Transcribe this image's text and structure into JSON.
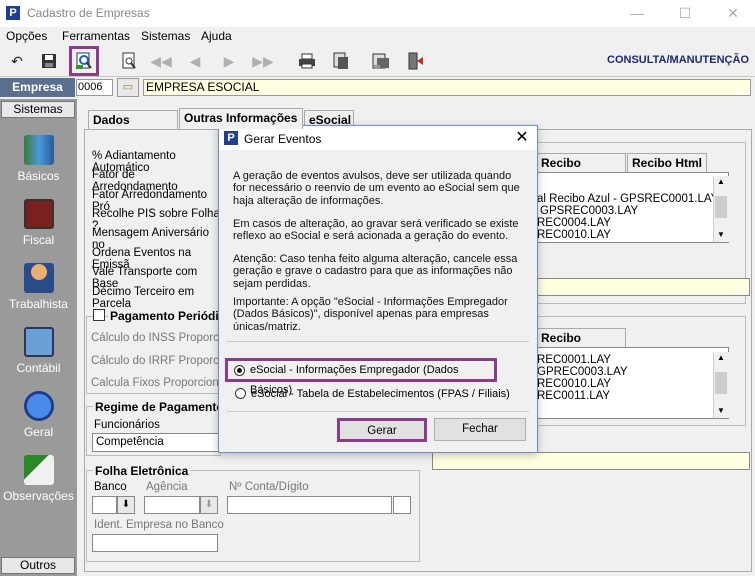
{
  "window": {
    "title": "Cadastro de Empresas",
    "icon_letter": "P",
    "minimize": "—",
    "maximize": "☐",
    "close": "✕"
  },
  "menu": [
    "Opções",
    "Ferramentas",
    "Sistemas",
    "Ajuda"
  ],
  "toolbar": {
    "mode_label": "CONSULTA/MANUTENÇÃO"
  },
  "empresa": {
    "label": "Empresa",
    "code": "0006",
    "name": "EMPRESA ESOCIAL"
  },
  "sidebar": {
    "header": "Sistemas",
    "footer": "Outros",
    "items": [
      {
        "label": "Básicos",
        "icon": "books-icon"
      },
      {
        "label": "Fiscal",
        "icon": "calculator-icon"
      },
      {
        "label": "Trabalhista",
        "icon": "worker-icon"
      },
      {
        "label": "Contábil",
        "icon": "calculator-icon"
      },
      {
        "label": "Geral",
        "icon": "info-icon"
      },
      {
        "label": "Observações",
        "icon": "notepad-icon"
      }
    ]
  },
  "tabs": [
    "Dados Básicos",
    "Outras Informações",
    "eSocial"
  ],
  "form": {
    "labels": [
      "% Adiantamento Automático",
      "Fator de Arredondamento",
      "Fator Arredondamento Pró",
      "Recolhe PIS sobre Folha ?",
      "Mensagem Aniversário no",
      "Ordena Eventos na Emissã",
      "Vale Transporte com Base",
      "Décimo Terceiro em Parcela"
    ],
    "pagamento_group": "Pagamento Periódic",
    "pagamento_labels": [
      "Cálculo do INSS Proporcior",
      "Cálculo do IRRF Proporcior",
      "Calcula Fixos Proporcional"
    ],
    "regime_group": "Regime de Pagamento",
    "funcionarios_label": "Funcionários",
    "funcionarios_value": "Competência",
    "folha_group": "Folha Eletrônica",
    "banco_label": "Banco",
    "agencia_label": "Agência",
    "conta_label": "Nº Conta/Dígito",
    "ident_label": "Ident. Empresa no Banco"
  },
  "right_panel": {
    "tabs_top": [
      "Recibo Gráfico",
      "Recibo Html"
    ],
    "list_top": [
      "al Recibo Azul - GPSREC0001.LAY",
      "GPSREC0003.LAY",
      "REC0004.LAY",
      "REC0010.LAY"
    ],
    "tabs_bottom": [
      "Recibo Gráfico"
    ],
    "list_bottom": [
      "REC0001.LAY",
      "GPREC0003.LAY",
      "REC0010.LAY",
      "REC0011.LAY"
    ]
  },
  "dialog": {
    "title": "Gerar Eventos",
    "close": "✕",
    "paragraphs": [
      "A geração de eventos avulsos, deve ser utilizada quando for necessário o reenvio de um evento ao eSocial sem que haja alteração de informações.",
      "Em casos de alteração, ao gravar será verificado se existe reflexo ao eSocial e será acionada a geração do evento.",
      "Atenção: Caso tenha feito alguma alteração, cancele essa geração e grave o cadastro para que as informações não sejam perdidas.",
      "Importante: A opção \"eSocial - Informações Empregador (Dados Básicos)\",  disponível apenas para empresas únicas/matriz."
    ],
    "options": [
      {
        "label": "eSocial - Informações Empregador (Dados Básicos)",
        "selected": true
      },
      {
        "label": "eSocial - Tabela de Estabelecimentos (FPAS /  Filiais)",
        "selected": false
      }
    ],
    "gerar": "Gerar",
    "fechar": "Fechar"
  },
  "colors": {
    "highlight": "#8a3c8a",
    "sidebar": "#9a9a9a",
    "empresa_label_bg": "#5b6f8f",
    "field_yellow": "#ffffe1"
  }
}
